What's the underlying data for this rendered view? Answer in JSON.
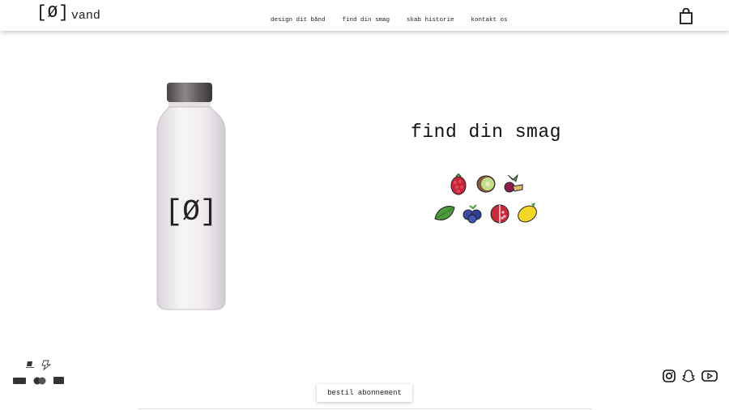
{
  "header": {
    "logo_mark": "[Ø]",
    "logo_text": "vand",
    "nav": [
      "design dit bånd",
      "find din smag",
      "skab historie",
      "kontakt os"
    ],
    "cart_icon": "shopping-bag-icon"
  },
  "main": {
    "product_image": "water-bottle",
    "bottle_logo": "[Ø]",
    "title": "find din smag",
    "flavors_row1": [
      "raspberry-icon",
      "kiwi-icon",
      "ginger-beet-icon"
    ],
    "flavors_row2": [
      "leaf-icon",
      "blueberry-icon",
      "pomegranate-icon",
      "lemon-icon"
    ]
  },
  "footer": {
    "payment_icons": [
      "mobilepay-icon",
      "lightning-icon",
      "dankort-icon",
      "mastercard-icon",
      "visa-icon"
    ],
    "social_icons": [
      "instagram-icon",
      "snapchat-icon",
      "youtube-icon"
    ],
    "subscribe_label": "bestil abonnement"
  }
}
